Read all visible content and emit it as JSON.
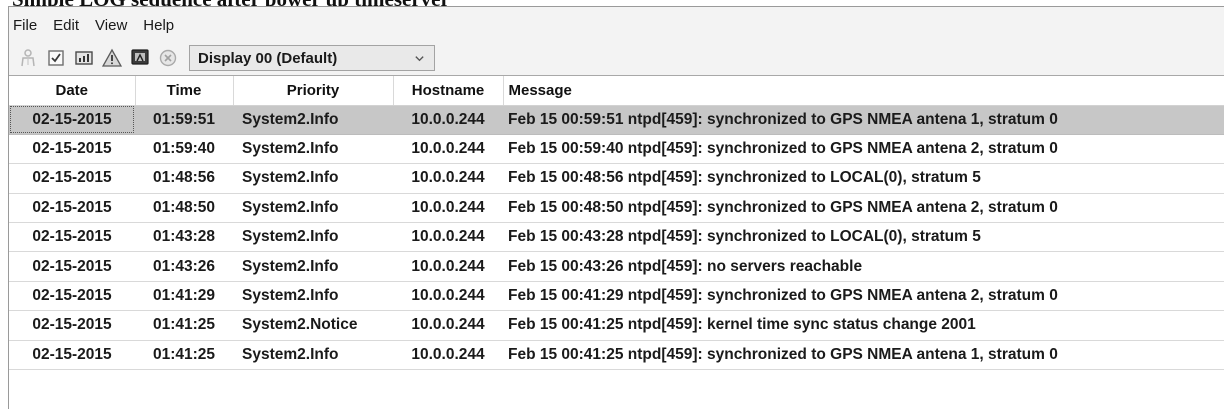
{
  "caption": "Simple LOG sequence after power up timeserver",
  "menu": [
    "File",
    "Edit",
    "View",
    "Help"
  ],
  "toolbar": {
    "icons": [
      "person-icon",
      "checkbox-icon",
      "chart-icon",
      "warning-icon",
      "screen-icon",
      "cancel-icon"
    ],
    "display_select": "Display 00 (Default)"
  },
  "columns": {
    "date": "Date",
    "time": "Time",
    "priority": "Priority",
    "hostname": "Hostname",
    "message": "Message"
  },
  "rows": [
    {
      "date": "02-15-2015",
      "time": "01:59:51",
      "priority": "System2.Info",
      "hostname": "10.0.0.244",
      "message": "Feb 15 00:59:51 ntpd[459]: synchronized to GPS NMEA antena 1, stratum 0"
    },
    {
      "date": "02-15-2015",
      "time": "01:59:40",
      "priority": "System2.Info",
      "hostname": "10.0.0.244",
      "message": "Feb 15 00:59:40 ntpd[459]: synchronized to GPS NMEA antena 2, stratum 0"
    },
    {
      "date": "02-15-2015",
      "time": "01:48:56",
      "priority": "System2.Info",
      "hostname": "10.0.0.244",
      "message": "Feb 15 00:48:56 ntpd[459]: synchronized to LOCAL(0), stratum 5"
    },
    {
      "date": "02-15-2015",
      "time": "01:48:50",
      "priority": "System2.Info",
      "hostname": "10.0.0.244",
      "message": "Feb 15 00:48:50 ntpd[459]: synchronized to GPS NMEA antena 2, stratum 0"
    },
    {
      "date": "02-15-2015",
      "time": "01:43:28",
      "priority": "System2.Info",
      "hostname": "10.0.0.244",
      "message": "Feb 15 00:43:28 ntpd[459]: synchronized to LOCAL(0), stratum 5"
    },
    {
      "date": "02-15-2015",
      "time": "01:43:26",
      "priority": "System2.Info",
      "hostname": "10.0.0.244",
      "message": "Feb 15 00:43:26 ntpd[459]: no servers reachable"
    },
    {
      "date": "02-15-2015",
      "time": "01:41:29",
      "priority": "System2.Info",
      "hostname": "10.0.0.244",
      "message": "Feb 15 00:41:29 ntpd[459]: synchronized to GPS NMEA antena 2, stratum 0"
    },
    {
      "date": "02-15-2015",
      "time": "01:41:25",
      "priority": "System2.Notice",
      "hostname": "10.0.0.244",
      "message": "Feb 15 00:41:25 ntpd[459]: kernel time sync status change 2001"
    },
    {
      "date": "02-15-2015",
      "time": "01:41:25",
      "priority": "System2.Info",
      "hostname": "10.0.0.244",
      "message": "Feb 15 00:41:25 ntpd[459]: synchronized to GPS NMEA antena 1, stratum 0"
    }
  ],
  "selected_row": 0
}
